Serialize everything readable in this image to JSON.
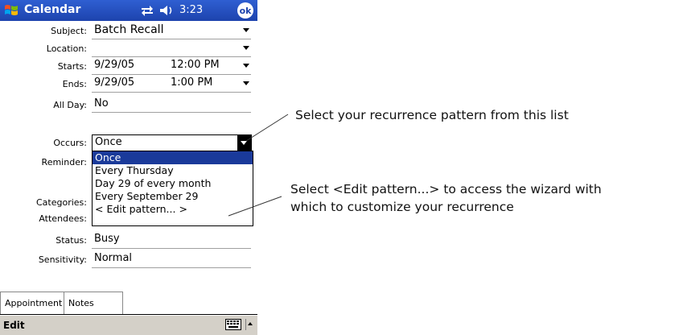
{
  "titlebar": {
    "app_title": "Calendar",
    "clock": "3:23",
    "ok_label": "ok"
  },
  "form": {
    "subject": {
      "label": "Subject:",
      "value": "Batch Recall"
    },
    "location": {
      "label": "Location:",
      "value": ""
    },
    "starts": {
      "label": "Starts:",
      "date": "9/29/05",
      "time": "12:00 PM"
    },
    "ends": {
      "label": "Ends:",
      "date": "9/29/05",
      "time": "1:00 PM"
    },
    "all_day": {
      "label": "All Day:",
      "value": "No"
    },
    "occurs": {
      "label": "Occurs:",
      "value": "Once",
      "options": [
        "Once",
        "Every Thursday",
        "Day 29 of every month",
        "Every September 29",
        "< Edit pattern... >"
      ]
    },
    "reminder": {
      "label": "Reminder:"
    },
    "categories": {
      "label": "Categories:"
    },
    "attendees": {
      "label": "Attendees:"
    },
    "status": {
      "label": "Status:",
      "value": "Busy"
    },
    "sensitivity": {
      "label": "Sensitivity:",
      "value": "Normal"
    }
  },
  "tabs": [
    {
      "label": "Appointment"
    },
    {
      "label": "Notes"
    }
  ],
  "menubar": {
    "edit_label": "Edit"
  },
  "callouts": {
    "first": "Select your recurrence pattern from this list",
    "second_line1": "Select <Edit pattern...> to access the wizard with",
    "second_line2": "which to customize your recurrence"
  },
  "colors": {
    "titlebar": "#1d43ad",
    "selection": "#1a3a9a",
    "menubar": "#d4d0c8"
  },
  "icons": [
    "windows-start-icon",
    "connectivity-icon",
    "volume-icon",
    "keyboard-icon",
    "sip-arrow-icon"
  ]
}
